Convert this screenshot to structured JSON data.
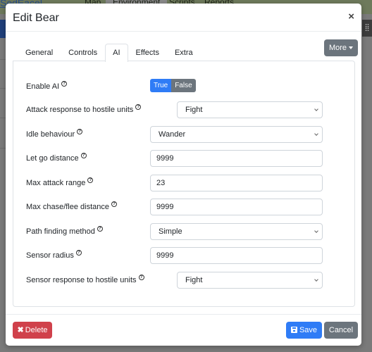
{
  "background": {
    "brand": "SedEacel",
    "nav": [
      "Map",
      "Environment",
      "Scripts",
      "Reports"
    ],
    "active_nav": "Environment"
  },
  "modal": {
    "title": "Edit Bear",
    "close_icon": "×",
    "tabs": [
      {
        "label": "General",
        "active": false
      },
      {
        "label": "Controls",
        "active": false
      },
      {
        "label": "AI",
        "active": true
      },
      {
        "label": "Effects",
        "active": false
      },
      {
        "label": "Extra",
        "active": false
      }
    ],
    "more_label": "More",
    "fields": {
      "enable_ai": {
        "label": "Enable AI",
        "true_label": "True",
        "false_label": "False",
        "value": true
      },
      "attack_response": {
        "label": "Attack response to hostile units",
        "value": "Fight"
      },
      "idle_behaviour": {
        "label": "Idle behaviour",
        "value": "Wander"
      },
      "let_go_distance": {
        "label": "Let go distance",
        "value": "9999"
      },
      "max_attack_range": {
        "label": "Max attack range",
        "value": "23"
      },
      "max_chase_flee": {
        "label": "Max chase/flee distance",
        "value": "9999"
      },
      "path_finding": {
        "label": "Path finding method",
        "value": "Simple"
      },
      "sensor_radius": {
        "label": "Sensor radius",
        "value": "9999"
      },
      "sensor_response": {
        "label": "Sensor response to hostile units",
        "value": "Fight"
      }
    },
    "help_icon": "?",
    "footer": {
      "delete_label": "Delete",
      "save_label": "Save",
      "cancel_label": "Cancel"
    }
  },
  "colors": {
    "primary": "#2f7cf6",
    "secondary": "#6c757d",
    "danger": "#d0414b"
  }
}
